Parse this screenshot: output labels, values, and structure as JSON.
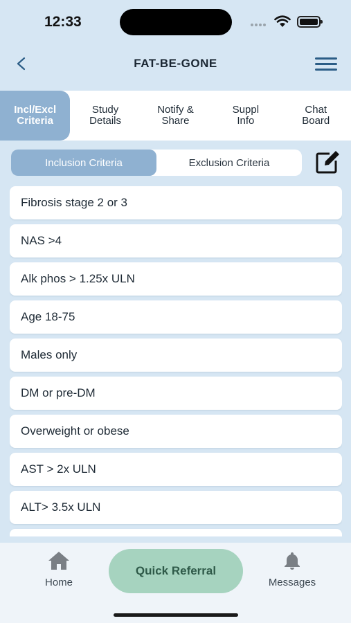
{
  "status_bar": {
    "time": "12:33"
  },
  "header": {
    "title": "FAT-BE-GONE"
  },
  "tabs": [
    {
      "label": "Incl/Excl\nCriteria",
      "active": true
    },
    {
      "label": "Study\nDetails",
      "active": false
    },
    {
      "label": "Notify &\nShare",
      "active": false
    },
    {
      "label": "Suppl\nInfo",
      "active": false
    },
    {
      "label": "Chat\nBoard",
      "active": false
    }
  ],
  "segments": {
    "inclusion": "Inclusion Criteria",
    "exclusion": "Exclusion Criteria",
    "selected": "inclusion"
  },
  "criteria": [
    "Fibrosis stage 2 or 3",
    "NAS >4",
    "Alk phos > 1.25x ULN",
    "Age 18-75",
    "Males only",
    "DM or pre-DM",
    "Overweight or obese",
    "AST > 2x ULN",
    "ALT> 3.5x ULN"
  ],
  "bottom_nav": {
    "home": "Home",
    "quick_referral": "Quick Referral",
    "messages": "Messages"
  },
  "colors": {
    "background": "#d6e6f3",
    "accent": "#8fb1d1",
    "quick_referral": "#a6d3bf",
    "menu_icon": "#2b5d86"
  },
  "icons": {
    "back": "chevron-left-icon",
    "menu": "hamburger-menu-icon",
    "edit": "edit-note-icon",
    "home": "house-icon",
    "messages": "bell-icon"
  }
}
